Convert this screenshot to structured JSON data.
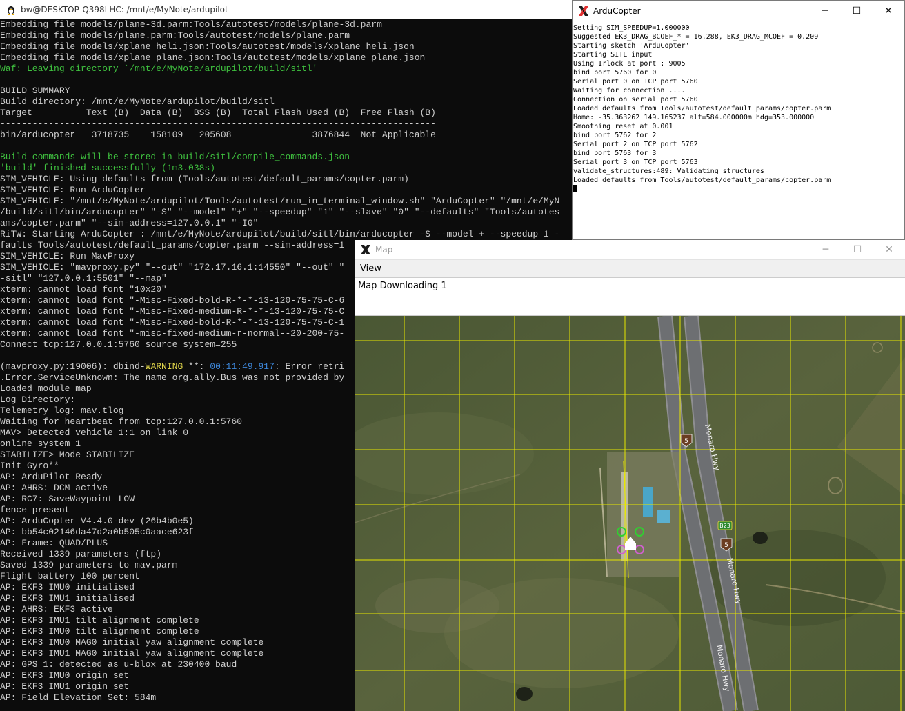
{
  "terminal": {
    "title": "bw@DESKTOP-Q398LHC: /mnt/e/MyNote/ardupilot",
    "lines": [
      {
        "t": "Embedding file models/plane-3d.parm:Tools/autotest/models/plane-3d.parm"
      },
      {
        "t": "Embedding file models/plane.parm:Tools/autotest/models/plane.parm"
      },
      {
        "t": "Embedding file models/xplane_heli.json:Tools/autotest/models/xplane_heli.json"
      },
      {
        "t": "Embedding file models/xplane_plane.json:Tools/autotest/models/xplane_plane.json"
      },
      {
        "t": "Waf: Leaving directory `/mnt/e/MyNote/ardupilot/build/sitl'",
        "c": "green"
      },
      {
        "t": ""
      },
      {
        "t": "BUILD SUMMARY"
      },
      {
        "t": "Build directory: /mnt/e/MyNote/ardupilot/build/sitl"
      },
      {
        "t": "Target          Text (B)  Data (B)  BSS (B)  Total Flash Used (B)  Free Flash (B)"
      },
      {
        "t": "---------------------------------------------------------------------------------"
      },
      {
        "t": "bin/arducopter   3718735    158109   205608               3876844  Not Applicable"
      },
      {
        "t": ""
      },
      {
        "t": "Build commands will be stored in build/sitl/compile_commands.json",
        "c": "green"
      },
      {
        "t": "'build' finished successfully (1m3.038s)",
        "c": "green"
      },
      {
        "t": "SIM_VEHICLE: Using defaults from (Tools/autotest/default_params/copter.parm)"
      },
      {
        "t": "SIM_VEHICLE: Run ArduCopter"
      },
      {
        "t": "SIM_VEHICLE: \"/mnt/e/MyNote/ardupilot/Tools/autotest/run_in_terminal_window.sh\" \"ArduCopter\" \"/mnt/e/MyN"
      },
      {
        "t": "/build/sitl/bin/arducopter\" \"-S\" \"--model\" \"+\" \"--speedup\" \"1\" \"--slave\" \"0\" \"--defaults\" \"Tools/autotes"
      },
      {
        "t": "ams/copter.parm\" \"--sim-address=127.0.0.1\" \"-I0\""
      },
      {
        "t": "RiTW: Starting ArduCopter : /mnt/e/MyNote/ardupilot/build/sitl/bin/arducopter -S --model + --speedup 1 -"
      },
      {
        "t": "faults Tools/autotest/default_params/copter.parm --sim-address=1"
      },
      {
        "t": "SIM_VEHICLE: Run MavProxy"
      },
      {
        "t": "SIM_VEHICLE: \"mavproxy.py\" \"--out\" \"172.17.16.1:14550\" \"--out\" \""
      },
      {
        "t": "-sitl\" \"127.0.0.1:5501\" \"--map\""
      },
      {
        "t": "xterm: cannot load font \"10x20\""
      },
      {
        "t": "xterm: cannot load font \"-Misc-Fixed-bold-R-*-*-13-120-75-75-C-6"
      },
      {
        "t": "xterm: cannot load font \"-Misc-Fixed-medium-R-*-*-13-120-75-75-C"
      },
      {
        "t": "xterm: cannot load font \"-Misc-Fixed-bold-R-*-*-13-120-75-75-C-1"
      },
      {
        "t": "xterm: cannot load font \"-misc-fixed-medium-r-normal--20-200-75-"
      },
      {
        "t": "Connect tcp:127.0.0.1:5760 source_system=255"
      },
      {
        "t": ""
      },
      {
        "t": "(mavproxy.py:19006): dbind-",
        "w": "WARNING",
        "r": " **: ",
        "time": "00:11:49.917",
        "e": ": Error retri"
      },
      {
        "t": ".Error.ServiceUnknown: The name org.ally.Bus was not provided by"
      },
      {
        "t": "Loaded module map"
      },
      {
        "t": "Log Directory:"
      },
      {
        "t": "Telemetry log: mav.tlog"
      },
      {
        "t": "Waiting for heartbeat from tcp:127.0.0.1:5760"
      },
      {
        "t": "MAV> Detected vehicle 1:1 on link 0"
      },
      {
        "t": "online system 1"
      },
      {
        "t": "STABILIZE> Mode STABILIZE"
      },
      {
        "t": "Init Gyro**"
      },
      {
        "t": "AP: ArduPilot Ready"
      },
      {
        "t": "AP: AHRS: DCM active"
      },
      {
        "t": "AP: RC7: SaveWaypoint LOW"
      },
      {
        "t": "fence present"
      },
      {
        "t": "AP: ArduCopter V4.4.0-dev (26b4b0e5)"
      },
      {
        "t": "AP: bb54c02146da47d2a0b505c0aace623f"
      },
      {
        "t": "AP: Frame: QUAD/PLUS"
      },
      {
        "t": "Received 1339 parameters (ftp)"
      },
      {
        "t": "Saved 1339 parameters to mav.parm"
      },
      {
        "t": "Flight battery 100 percent"
      },
      {
        "t": "AP: EKF3 IMU0 initialised"
      },
      {
        "t": "AP: EKF3 IMU1 initialised"
      },
      {
        "t": "AP: AHRS: EKF3 active"
      },
      {
        "t": "AP: EKF3 IMU1 tilt alignment complete"
      },
      {
        "t": "AP: EKF3 IMU0 tilt alignment complete"
      },
      {
        "t": "AP: EKF3 IMU0 MAG0 initial yaw alignment complete"
      },
      {
        "t": "AP: EKF3 IMU1 MAG0 initial yaw alignment complete"
      },
      {
        "t": "AP: GPS 1: detected as u-blox at 230400 baud"
      },
      {
        "t": "AP: EKF3 IMU0 origin set"
      },
      {
        "t": "AP: EKF3 IMU1 origin set"
      },
      {
        "t": "AP: Field Elevation Set: 584m"
      }
    ]
  },
  "ardu": {
    "title": "ArduCopter",
    "buttons": {
      "min": "─",
      "max": "☐",
      "close": "✕"
    },
    "lines": [
      "Setting SIM_SPEEDUP=1.000000",
      "Suggested EK3_DRAG_BCOEF_* = 16.288, EK3_DRAG_MCOEF = 0.209",
      "Starting sketch 'ArduCopter'",
      "Starting SITL input",
      "Using Irlock at port : 9005",
      "bind port 5760 for 0",
      "Serial port 0 on TCP port 5760",
      "Waiting for connection ....",
      "Connection on serial port 5760",
      "Loaded defaults from Tools/autotest/default_params/copter.parm",
      "Home: -35.363262 149.165237 alt=584.000000m hdg=353.000000",
      "Smoothing reset at 0.001",
      "bind port 5762 for 2",
      "Serial port 2 on TCP port 5762",
      "bind port 5763 for 3",
      "Serial port 3 on TCP port 5763",
      "validate_structures:489: Validating structures",
      "Loaded defaults from Tools/autotest/default_params/copter.parm"
    ]
  },
  "map": {
    "title": "Map",
    "buttons": {
      "min": "─",
      "max": "☐",
      "close": "✕"
    },
    "menu": {
      "view": "View"
    },
    "status": "Map Downloading 1",
    "labels": {
      "road1": "Monaro Hwy",
      "road2": "Monaro Hwy",
      "road3": "Monaro Hwy",
      "shield1": "5",
      "shield2": "5",
      "shield3": "B23"
    },
    "colors": {
      "grid": "#e6e600",
      "terrain": "#4c5a36",
      "road": "#6d6f72"
    }
  }
}
